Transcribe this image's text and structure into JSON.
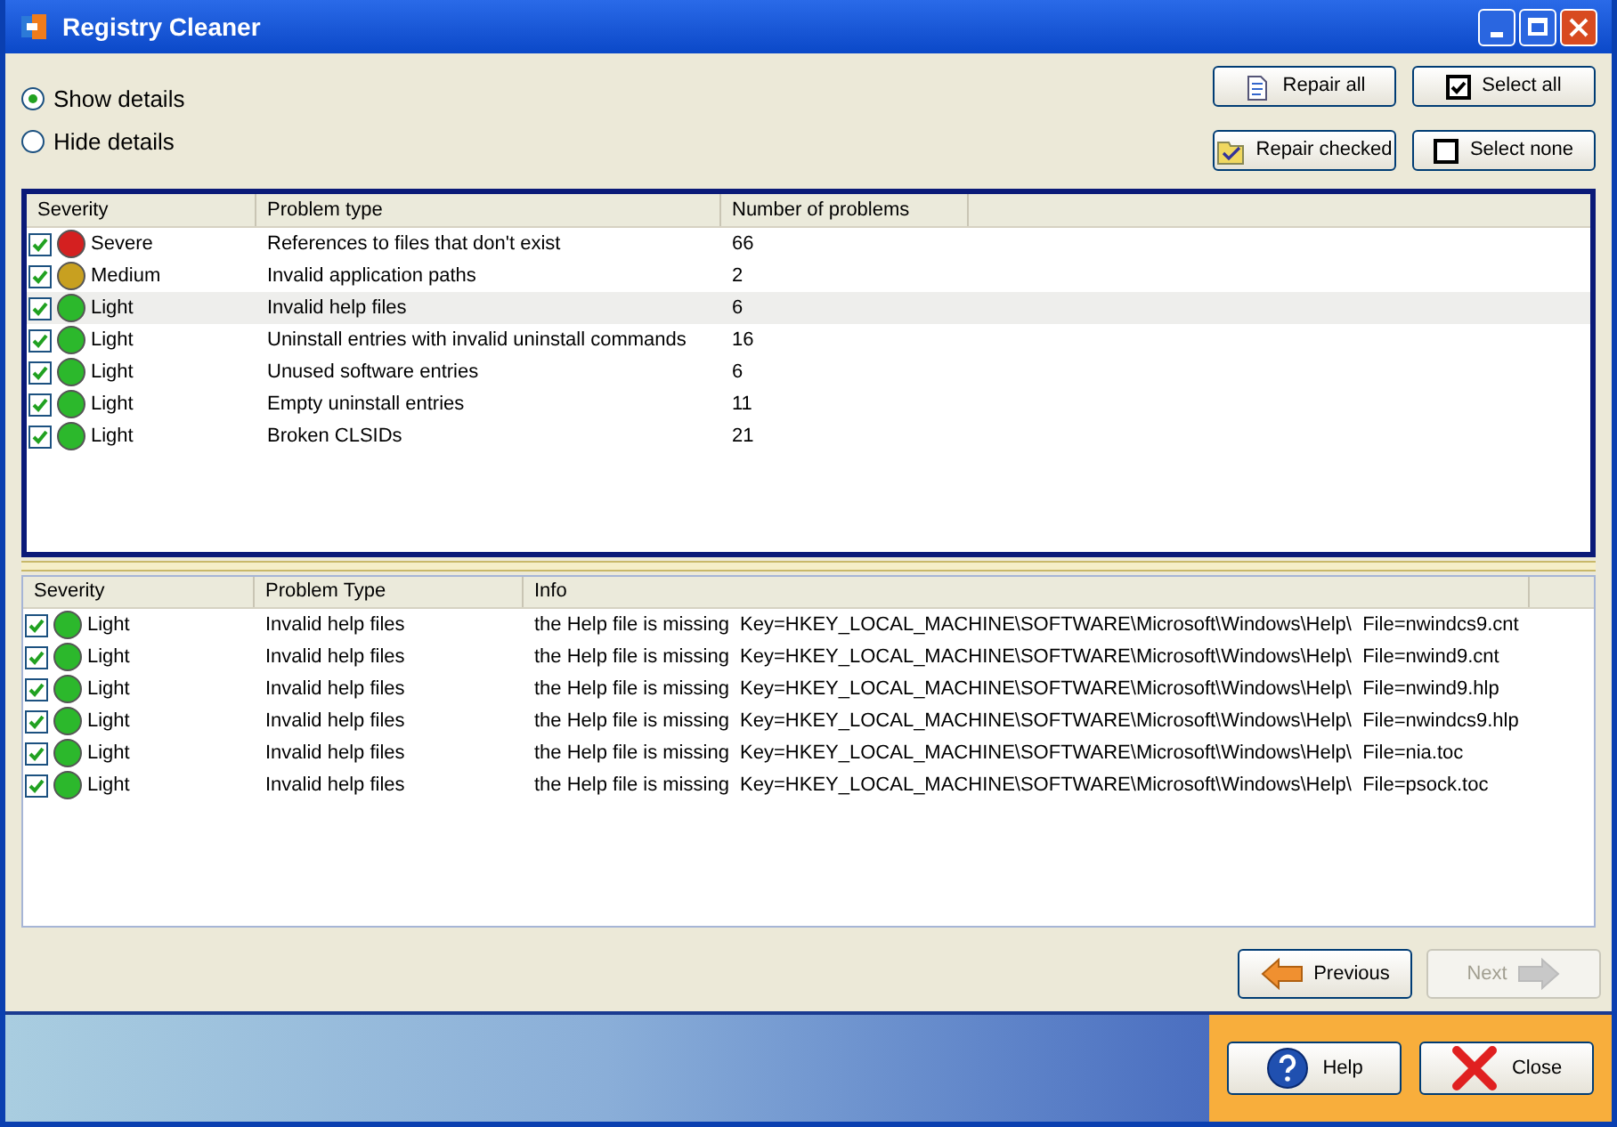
{
  "window": {
    "title": "Registry Cleaner"
  },
  "view_options": [
    {
      "label": "Show details",
      "selected": true
    },
    {
      "label": "Hide details",
      "selected": false
    }
  ],
  "actions": [
    {
      "label": "Repair all",
      "kind": "repair-all"
    },
    {
      "label": "Select all",
      "kind": "select-all"
    },
    {
      "label": "Repair checked",
      "kind": "repair-checked"
    },
    {
      "label": "Select none",
      "kind": "select-none"
    }
  ],
  "summary_table": {
    "columns": [
      "Severity",
      "Problem type",
      "Number of problems"
    ],
    "rows": [
      {
        "checked": true,
        "color": "#d42020",
        "severity": "Severe",
        "problem_type": "References to files that don't exist",
        "count": "66",
        "selected": false
      },
      {
        "checked": true,
        "color": "#c8a020",
        "severity": "Medium",
        "problem_type": "Invalid application paths",
        "count": "2",
        "selected": false
      },
      {
        "checked": true,
        "color": "#2cb82c",
        "severity": "Light",
        "problem_type": "Invalid help files",
        "count": "6",
        "selected": true
      },
      {
        "checked": true,
        "color": "#2cb82c",
        "severity": "Light",
        "problem_type": "Uninstall entries with invalid uninstall commands",
        "count": "16",
        "selected": false
      },
      {
        "checked": true,
        "color": "#2cb82c",
        "severity": "Light",
        "problem_type": "Unused software entries",
        "count": "6",
        "selected": false
      },
      {
        "checked": true,
        "color": "#2cb82c",
        "severity": "Light",
        "problem_type": "Empty uninstall entries",
        "count": "11",
        "selected": false
      },
      {
        "checked": true,
        "color": "#2cb82c",
        "severity": "Light",
        "problem_type": "Broken CLSIDs",
        "count": "21",
        "selected": false
      }
    ]
  },
  "details_table": {
    "columns": [
      "Severity",
      "Problem Type",
      "Info"
    ],
    "rows": [
      {
        "checked": true,
        "color": "#2cb82c",
        "severity": "Light",
        "problem_type": "Invalid help files",
        "info": "the Help file is missing  Key=HKEY_LOCAL_MACHINE\\SOFTWARE\\Microsoft\\Windows\\Help\\  File=nwindcs9.cnt"
      },
      {
        "checked": true,
        "color": "#2cb82c",
        "severity": "Light",
        "problem_type": "Invalid help files",
        "info": "the Help file is missing  Key=HKEY_LOCAL_MACHINE\\SOFTWARE\\Microsoft\\Windows\\Help\\  File=nwind9.cnt"
      },
      {
        "checked": true,
        "color": "#2cb82c",
        "severity": "Light",
        "problem_type": "Invalid help files",
        "info": "the Help file is missing  Key=HKEY_LOCAL_MACHINE\\SOFTWARE\\Microsoft\\Windows\\Help\\  File=nwind9.hlp"
      },
      {
        "checked": true,
        "color": "#2cb82c",
        "severity": "Light",
        "problem_type": "Invalid help files",
        "info": "the Help file is missing  Key=HKEY_LOCAL_MACHINE\\SOFTWARE\\Microsoft\\Windows\\Help\\  File=nwindcs9.hlp"
      },
      {
        "checked": true,
        "color": "#2cb82c",
        "severity": "Light",
        "problem_type": "Invalid help files",
        "info": "the Help file is missing  Key=HKEY_LOCAL_MACHINE\\SOFTWARE\\Microsoft\\Windows\\Help\\  File=nia.toc"
      },
      {
        "checked": true,
        "color": "#2cb82c",
        "severity": "Light",
        "problem_type": "Invalid help files",
        "info": "the Help file is missing  Key=HKEY_LOCAL_MACHINE\\SOFTWARE\\Microsoft\\Windows\\Help\\  File=psock.toc"
      }
    ]
  },
  "navigation": [
    {
      "label": "Previous",
      "kind": "previous",
      "disabled": false
    },
    {
      "label": "Next",
      "kind": "next",
      "disabled": true
    }
  ],
  "footer_buttons": [
    {
      "label": "Help",
      "kind": "help"
    },
    {
      "label": "Close",
      "kind": "close"
    }
  ]
}
